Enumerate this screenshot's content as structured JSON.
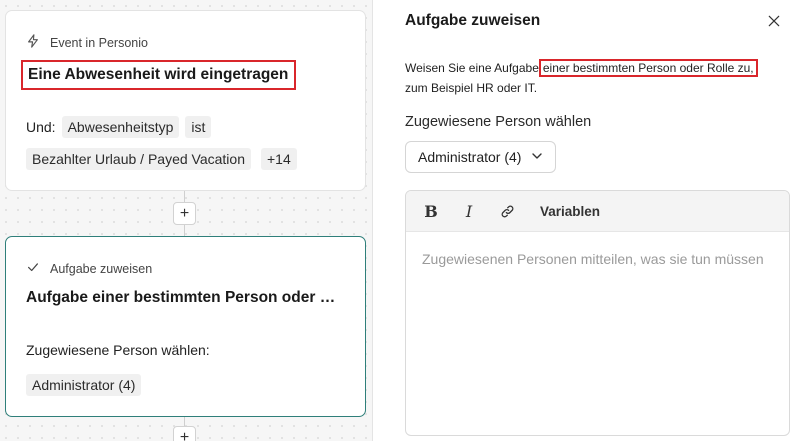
{
  "trigger_card": {
    "header": "Event in Personio",
    "header_icon": "lightning-icon",
    "title": "Eine Abwesenheit wird eingetragen",
    "condition_prefix": "Und:",
    "condition_field": "Abwesenheitstyp",
    "condition_operator": "ist",
    "condition_value": "Bezahlter Urlaub / Payed Vacation",
    "condition_more": "+14"
  },
  "action_card": {
    "header": "Aufgabe zuweisen",
    "header_icon": "check-icon",
    "title": "Aufgabe einer bestimmten Person oder Rolle zu, zum Beispiel HR oder IT.",
    "field_label": "Zugewiesene Person wählen:",
    "field_value": "Administrator (4)"
  },
  "add_step_label": "+",
  "panel": {
    "title": "Aufgabe zuweisen",
    "close_icon": "close-icon",
    "description_before": "Weisen Sie eine Aufgabe",
    "description_highlight": "einer bestimmten Person oder Rolle zu,",
    "description_after": "zum Beispiel HR oder IT.",
    "assignee_label": "Zugewiesene Person wählen",
    "assignee_value": "Administrator (4)",
    "editor": {
      "bold_label": "B",
      "italic_label": "I",
      "link_icon": "link-icon",
      "variables_label": "Variablen",
      "placeholder": "Zugewiesenen Personen mitteilen, was sie tun müssen"
    }
  },
  "colors": {
    "highlight_border": "#d9262b",
    "active_card_border": "#2f7f7a"
  }
}
